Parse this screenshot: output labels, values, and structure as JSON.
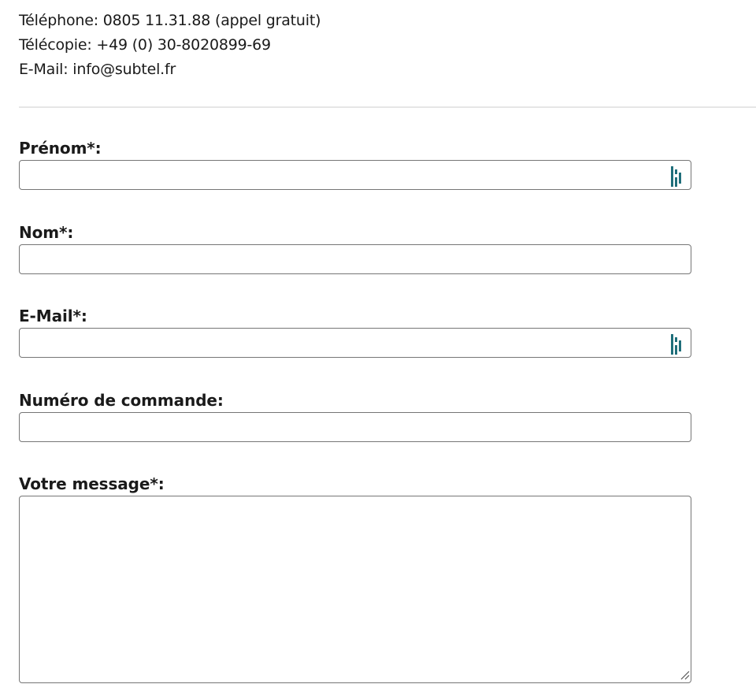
{
  "contact": {
    "phone": "Téléphone: 0805 11.31.88 (appel gratuit)",
    "fax": "Télécopie: +49 (0) 30-8020899-69",
    "email": "E-Mail: info@subtel.fr"
  },
  "form": {
    "firstname": {
      "label": "Prénom*:",
      "value": "",
      "placeholder": ""
    },
    "lastname": {
      "label": "Nom*:",
      "value": "",
      "placeholder": ""
    },
    "email": {
      "label": "E-Mail*:",
      "value": "",
      "placeholder": ""
    },
    "order_number": {
      "label": "Numéro de commande:",
      "value": "",
      "placeholder": ""
    },
    "message": {
      "label": "Votre message*:",
      "value": "",
      "placeholder": ""
    }
  },
  "icons": {
    "password_manager": "password-manager-icon",
    "resize": "resize-grip-icon"
  },
  "colors": {
    "password_manager_icon": "#1f6e7a",
    "field_border": "#767676",
    "divider": "#e6e6e6",
    "text": "#1a1a1a"
  }
}
